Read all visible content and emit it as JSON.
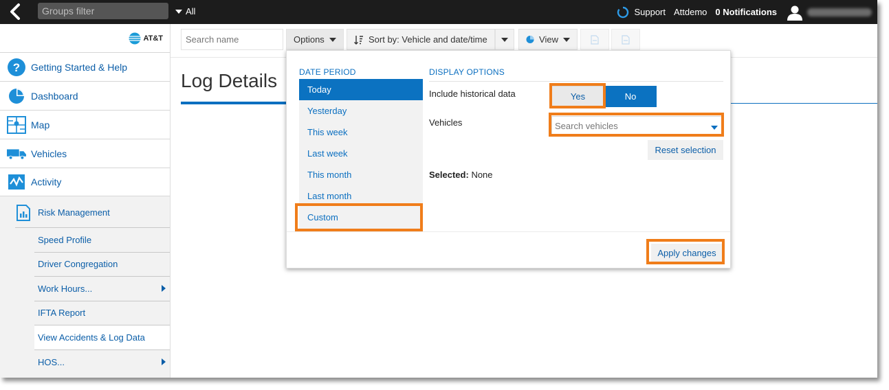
{
  "topbar": {
    "groups_filter_placeholder": "Groups filter",
    "groups_scope": "All",
    "support": "Support",
    "account": "Attdemo",
    "notifications": "0 Notifications"
  },
  "brand": {
    "logo_text": "AT&T"
  },
  "sidebar": {
    "items": [
      {
        "label": "Getting Started & Help",
        "icon": "help-icon"
      },
      {
        "label": "Dashboard",
        "icon": "pie-chart-icon"
      },
      {
        "label": "Map",
        "icon": "map-icon"
      },
      {
        "label": "Vehicles",
        "icon": "truck-icon"
      },
      {
        "label": "Activity",
        "icon": "activity-icon"
      }
    ],
    "risk_management": "Risk Management",
    "sub_items": [
      {
        "label": "Speed Profile",
        "has_submenu": false
      },
      {
        "label": "Driver Congregation",
        "has_submenu": false
      },
      {
        "label": "Work Hours...",
        "has_submenu": true
      },
      {
        "label": "IFTA Report",
        "has_submenu": false
      },
      {
        "label": "View Accidents & Log Data",
        "has_submenu": false
      },
      {
        "label": "HOS...",
        "has_submenu": true
      }
    ]
  },
  "toolbar": {
    "search_placeholder": "Search name",
    "options_label": "Options",
    "sort_label": "Sort by: Vehicle and date/time",
    "view_label": "View"
  },
  "page": {
    "title": "Log Details"
  },
  "options_panel": {
    "date_period_heading": "DATE PERIOD",
    "date_periods": [
      "Today",
      "Yesterday",
      "This week",
      "Last week",
      "This month",
      "Last month",
      "Custom"
    ],
    "selected_period": "Today",
    "display_options_heading": "DISPLAY OPTIONS",
    "historical_label": "Include historical data",
    "yes_label": "Yes",
    "no_label": "No",
    "historical_value": "No",
    "vehicles_label": "Vehicles",
    "vehicles_placeholder": "Search vehicles",
    "reset_label": "Reset selection",
    "selected_key": "Selected:",
    "selected_value": "None",
    "apply_label": "Apply changes"
  },
  "colors": {
    "accent_blue": "#0b72c1",
    "link_blue": "#0b5ea8",
    "highlight_orange": "#f07d1a",
    "topbar": "#1c1c1c"
  }
}
